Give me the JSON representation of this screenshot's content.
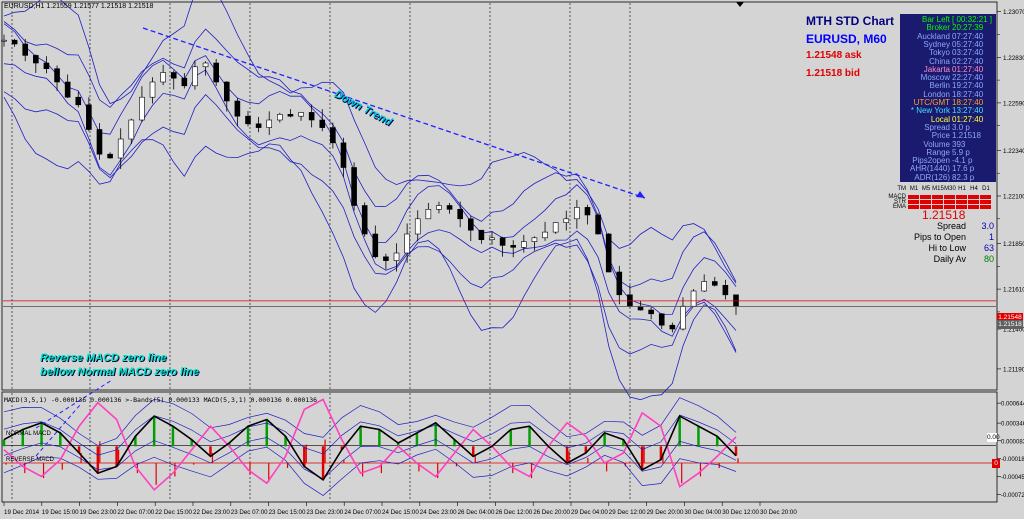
{
  "header": {
    "symbol_line": "EURUSD,H1  1.21559 1.21577 1.21518 1.21518",
    "macd_line": "MACD(3,5,1) -0.000136 0.000136  >-Bands(5) 0.000133  MACD(5,3,1) 0.000136 0.000136"
  },
  "overlay": {
    "title": "MTH STD Chart",
    "symbol": "EURUSD, M60",
    "ask": "1.21548 ask",
    "bid": "1.21518 bid"
  },
  "clock_panel": {
    "bg": "#1a1a6e",
    "rows": [
      {
        "label": "Bar Left",
        "value": "[ 00:32:21 ]",
        "color": "#00ff00"
      },
      {
        "label": "Broker",
        "value": "20:27:39",
        "color": "#00ff00"
      },
      {
        "label": "Auckland",
        "value": "07:27:40",
        "color": "#8ca8ff"
      },
      {
        "label": "Sydney",
        "value": "05:27:40",
        "color": "#8ca8ff"
      },
      {
        "label": "Tokyo",
        "value": "03:27:40",
        "color": "#8ca8ff"
      },
      {
        "label": "China",
        "value": "02:27:40",
        "color": "#8ca8ff"
      },
      {
        "label": "Jakarta",
        "value": "01:27:40",
        "color": "#ff8cc8"
      },
      {
        "label": "Moscow",
        "value": "22:27:40",
        "color": "#8ca8ff"
      },
      {
        "label": "Berlin",
        "value": "19:27:40",
        "color": "#8ca8ff"
      },
      {
        "label": "London",
        "value": "18:27:40",
        "color": "#8ca8ff"
      },
      {
        "label": "UTC/GMT",
        "value": "18:27:40",
        "color": "#ffa020"
      },
      {
        "label": "* New York",
        "value": "13:27:40",
        "color": "#40e0ff"
      },
      {
        "label": "Local",
        "value": "01:27:40",
        "color": "#ffff40"
      },
      {
        "label": "Spread",
        "value": "3.0 p",
        "color": "#8ca8ff"
      },
      {
        "label": "Price",
        "value": "1.21518",
        "color": "#8ca8ff"
      },
      {
        "label": "Volume",
        "value": "393",
        "color": "#8ca8ff"
      },
      {
        "label": "Range",
        "value": "5.9 p",
        "color": "#8ca8ff"
      },
      {
        "label": "Pips2open",
        "value": "-4.1 p",
        "color": "#8ca8ff"
      },
      {
        "label": "AHR(1440)",
        "value": "17.6 p",
        "color": "#8ca8ff"
      },
      {
        "label": "ADR(126)",
        "value": "82.3 p",
        "color": "#8ca8ff"
      }
    ]
  },
  "tf_grid": {
    "headers": [
      "M1",
      "M5",
      "M15",
      "M30",
      "H1",
      "H4",
      "D1"
    ],
    "rows": [
      "MACD",
      "STR",
      "EMA"
    ],
    "top_label": "TM",
    "cell_color": "#e00000"
  },
  "stats": {
    "price": "1.21518",
    "rows": [
      {
        "label": "Spread",
        "value": "3.0",
        "color": "#0000c0"
      },
      {
        "label": "Pips to Open",
        "value": "1",
        "color": "#0000c0"
      },
      {
        "label": "Hi to Low",
        "value": "63",
        "color": "#0000c0"
      },
      {
        "label": "Daily Av",
        "value": "80",
        "color": "#008000"
      }
    ]
  },
  "annotations": {
    "down_trend": "Down Trend",
    "macd_note_1": "Reverse MACD zero line",
    "macd_note_2": "bellow Normal MACD zero line",
    "normal_macd": "NORMAL MACD",
    "reverse_macd": "REVERSE MACD"
  },
  "axis_tags": {
    "ask": "1.21548",
    "bid": "1.21518",
    "zero": "0.00",
    "zero2": "0"
  },
  "chart_data": [
    {
      "type": "candlestick",
      "name_printed": "EURUSD,H1",
      "y_ticks": [
        "1.23070",
        "1.22830",
        "1.22590",
        "1.22340",
        "1.22100",
        "1.21850",
        "1.21610",
        "1.21400",
        "1.21190"
      ],
      "y_ticks_right": [
        "1.22950",
        "1.22710",
        "1.22470",
        "1.22220",
        "1.21980",
        "1.21730",
        "1.21490"
      ],
      "ylim": [
        1.211,
        1.231
      ],
      "x_ticks": [
        "19 Dec 2014",
        "19 Dec 15:00",
        "19 Dec 23:00",
        "22 Dec 07:00",
        "22 Dec 15:00",
        "22 Dec 23:00",
        "23 Dec 07:00",
        "23 Dec 15:00",
        "23 Dec 23:00",
        "24 Dec 07:00",
        "24 Dec 15:00",
        "24 Dec 23:00",
        "26 Dec 04:00",
        "26 Dec 12:00",
        "26 Dec 20:00",
        "29 Dec 04:00",
        "29 Dec 12:00",
        "29 Dec 20:00",
        "30 Dec 04:00",
        "30 Dec 12:00",
        "30 Dec 20:00"
      ],
      "close_path": [
        1.2292,
        1.229,
        1.2284,
        1.228,
        1.2277,
        1.227,
        1.2262,
        1.2258,
        1.2245,
        1.2232,
        1.223,
        1.224,
        1.225,
        1.2262,
        1.227,
        1.2275,
        1.2272,
        1.2268,
        1.2278,
        1.228,
        1.227,
        1.226,
        1.2252,
        1.2248,
        1.2246,
        1.225,
        1.2253,
        1.2252,
        1.2254,
        1.225,
        1.2246,
        1.2238,
        1.2225,
        1.2205,
        1.219,
        1.2178,
        1.2176,
        1.218,
        1.219,
        1.2198,
        1.2203,
        1.2205,
        1.2203,
        1.2198,
        1.2192,
        1.2187,
        1.2188,
        1.2184,
        1.2183,
        1.2186,
        1.2188,
        1.2191,
        1.2196,
        1.2198,
        1.2204,
        1.22,
        1.219,
        1.217,
        1.2158,
        1.2152,
        1.215,
        1.2148,
        1.2142,
        1.214,
        1.2152,
        1.216,
        1.2165,
        1.2163,
        1.2158,
        1.2152
      ],
      "resistance_line": {
        "from": [
          0.092,
          1.229
        ],
        "to": [
          0.628,
          1.2214
        ]
      },
      "horizontal_lines": [
        1.21548,
        1.21518
      ]
    },
    {
      "type": "line",
      "name_printed": "MACD(3,5,1)",
      "y_ticks": [
        "0.000644",
        "0.000346",
        "0.000083",
        "-0.000184",
        "-0.000453",
        "-0.000721"
      ],
      "ylim": [
        -0.0008,
        0.00075
      ],
      "normal_macd": [
        0.0001,
        0.00025,
        0.00035,
        0.0002,
        -0.0001,
        -0.0004,
        -0.0003,
        0.00015,
        0.00045,
        0.0003,
        0.0001,
        -0.00015,
        5e-05,
        0.0003,
        0.0004,
        0.00015,
        -0.0003,
        -0.0005,
        -5e-05,
        0.0003,
        0.00025,
        5e-05,
        0.0002,
        0.00035,
        0.0001,
        -0.00015,
        0.0,
        0.00025,
        0.0003,
        0.0,
        -0.00025,
        -0.0001,
        0.0002,
        0.0001,
        -0.00035,
        -0.0002,
        0.00045,
        0.0003,
        0.00015,
        -0.00014
      ],
      "reverse_macd": [
        -5e-05,
        -0.0003,
        -0.00045,
        -0.0002,
        0.0003,
        0.00065,
        0.0004,
        -0.0003,
        -0.00065,
        -0.0004,
        -5e-05,
        0.0003,
        0.0,
        -0.00035,
        -0.00055,
        -0.00015,
        0.00055,
        0.0007,
        0.0001,
        -0.0004,
        -0.0003,
        0.0,
        -0.00025,
        -0.00045,
        -0.0001,
        0.00025,
        0.0,
        -0.0003,
        -0.00045,
        0.0,
        0.00035,
        0.00015,
        -0.00025,
        -0.0001,
        0.0005,
        0.0003,
        -0.0006,
        -0.0004,
        -0.00015,
        0.00014
      ],
      "colors": {
        "normal": "#000000",
        "reverse": "#ff40c0",
        "bands": "#2020c0",
        "hist_up": "#00a000",
        "hist_dn": "#e00000"
      }
    }
  ]
}
